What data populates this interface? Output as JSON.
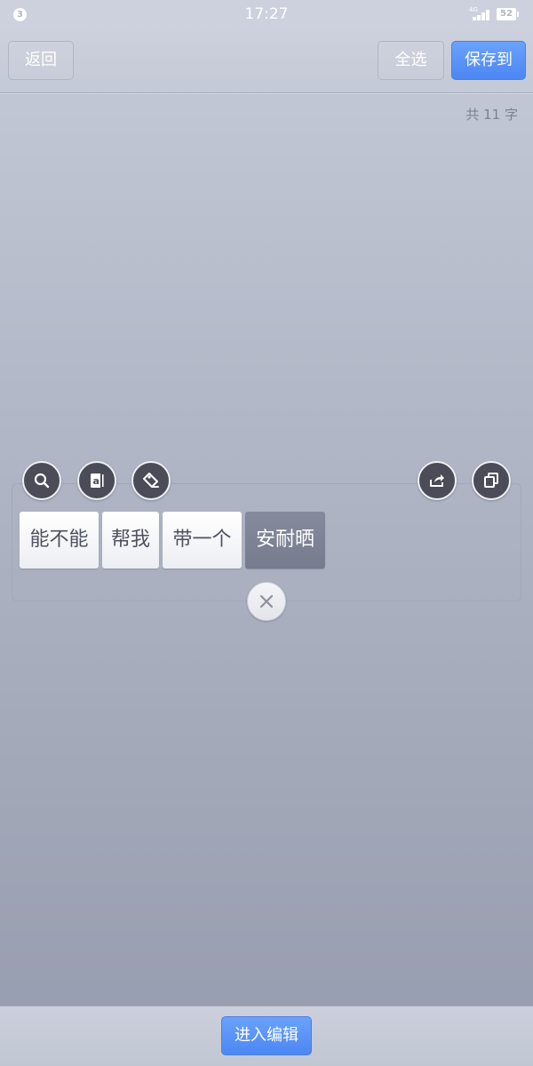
{
  "status_bar": {
    "notification_count": "3",
    "time": "17:27",
    "network": "4G",
    "battery": "52"
  },
  "top_bar": {
    "back_label": "返回",
    "select_all_label": "全选",
    "save_label": "保存到"
  },
  "char_count": "共 11 字",
  "toolbar": {
    "left_icons": [
      "search-icon",
      "dictionary-icon",
      "tag-icon"
    ],
    "right_icons": [
      "share-icon",
      "copy-icon"
    ]
  },
  "tokens": [
    {
      "text": "能不能",
      "selected": false
    },
    {
      "text": "帮我",
      "selected": false
    },
    {
      "text": "带一个",
      "selected": false
    },
    {
      "text": "安耐晒",
      "selected": true
    }
  ],
  "bottom_bar": {
    "edit_label": "进入编辑"
  },
  "colors": {
    "accent": "#4c87f3",
    "selected_token": "#7c8194"
  }
}
